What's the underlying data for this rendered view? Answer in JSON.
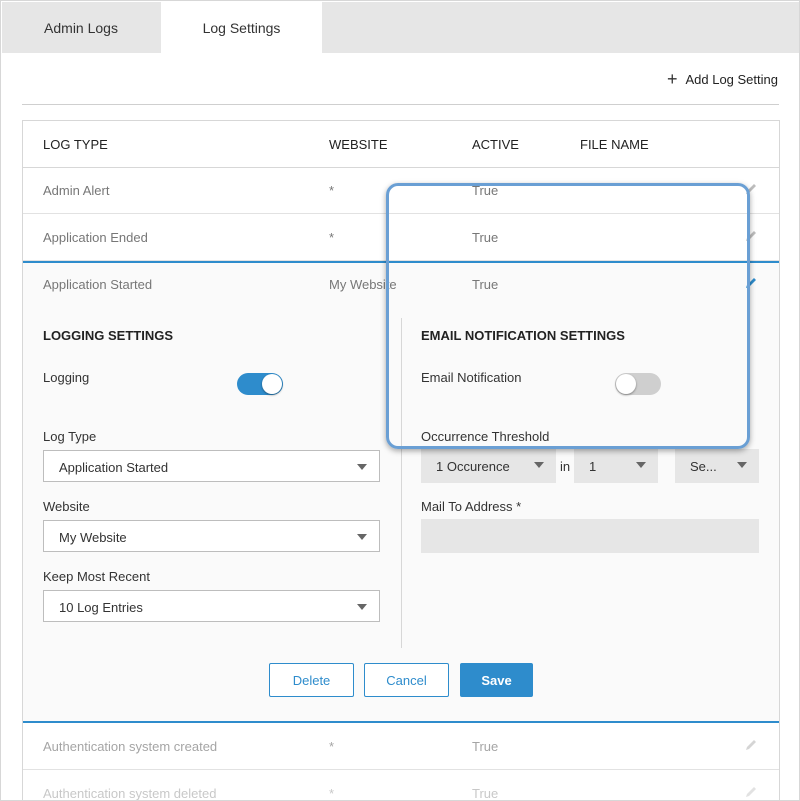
{
  "tabs": [
    {
      "label": "Admin Logs"
    },
    {
      "label": "Log Settings"
    }
  ],
  "toolbar": {
    "add_label": "Add Log Setting",
    "add_icon": "plus-icon"
  },
  "table": {
    "headers": {
      "log_type": "LOG TYPE",
      "website": "WEBSITE",
      "active": "ACTIVE",
      "file_name": "FILE NAME"
    },
    "rows": [
      {
        "log_type": "Admin Alert",
        "website": "*",
        "active": "True",
        "file_name": ""
      },
      {
        "log_type": "Application Ended",
        "website": "*",
        "active": "True",
        "file_name": ""
      },
      {
        "log_type": "Application Started",
        "website": "My Website",
        "active": "True",
        "file_name": ""
      },
      {
        "log_type": "Authentication system created",
        "website": "*",
        "active": "True",
        "file_name": ""
      },
      {
        "log_type": "Authentication system deleted",
        "website": "*",
        "active": "True",
        "file_name": ""
      }
    ]
  },
  "logging": {
    "title": "LOGGING SETTINGS",
    "logging_label": "Logging",
    "logging_on": true,
    "log_type_label": "Log Type",
    "log_type_value": "Application Started",
    "website_label": "Website",
    "website_value": "My Website",
    "keep_label": "Keep Most Recent",
    "keep_value": "10 Log Entries"
  },
  "email": {
    "title": "EMAIL NOTIFICATION SETTINGS",
    "notification_label": "Email Notification",
    "notification_on": false,
    "threshold_label": "Occurrence Threshold",
    "occurrence_value": "1 Occurence",
    "in_label": "in",
    "count_value": "1",
    "unit_value": "Se...",
    "mail_label": "Mail To Address *",
    "mail_value": ""
  },
  "actions": {
    "delete": "Delete",
    "cancel": "Cancel",
    "save": "Save"
  },
  "colors": {
    "accent": "#2e8ccc",
    "highlight": "#6a9fd4"
  }
}
